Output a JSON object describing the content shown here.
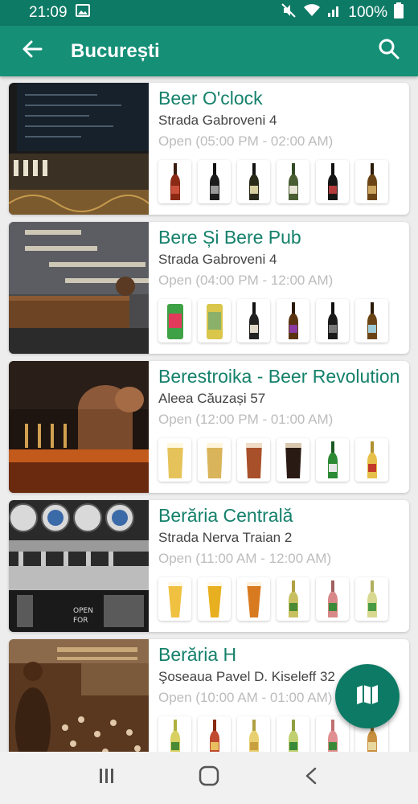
{
  "status": {
    "time": "21:09",
    "battery": "100%"
  },
  "colors": {
    "primary": "#168f77",
    "primary_dark": "#0d7a65",
    "name_text": "#15816b"
  },
  "appbar": {
    "title": "București",
    "back_icon": "arrow-left-icon",
    "search_icon": "search-icon"
  },
  "bars": [
    {
      "name": "Beer O'clock",
      "address": "Strada Gabroveni 4",
      "hours": "Open (05:00 PM - 02:00 AM)",
      "beers": [
        "bottle-red",
        "bottle-dark",
        "bottle-dark",
        "bottle-green",
        "bottle-dark",
        "bottle-amber"
      ]
    },
    {
      "name": "Bere Și Bere Pub",
      "address": "Strada Gabroveni 4",
      "hours": "Open (04:00 PM - 12:00 AM)",
      "beers": [
        "can-green",
        "can-yellow",
        "bottle-dark",
        "bottle-amber",
        "bottle-dark",
        "bottle-amber"
      ]
    },
    {
      "name": "Berestroika - Beer Revolution",
      "address": "Aleea Căuzași 57",
      "hours": "Open (12:00 PM - 01:00 AM)",
      "beers": [
        "glass-yellow",
        "glass-yellow",
        "glass-red",
        "glass-dark",
        "bottle-green",
        "bottle-yellow"
      ]
    },
    {
      "name": "Berăria Centrală",
      "address": "Strada Nerva Traian 2",
      "hours": "Open (11:00 AM - 12:00 AM)",
      "beers": [
        "glass-yellow",
        "glass-yellow",
        "glass-amber",
        "bottle-green",
        "bottle-red",
        "bottle-green"
      ]
    },
    {
      "name": "Berăria H",
      "address": "Şoseaua Pavel D. Kiseleff 32",
      "hours": "Open (10:00 AM - 01:00 AM)",
      "beers": [
        "bottle-green",
        "bottle-red",
        "bottle-yellow",
        "bottle-green",
        "bottle-red",
        "bottle-amber"
      ]
    }
  ],
  "fab": {
    "icon": "map-icon"
  },
  "navbar": {
    "recent_icon": "recent-apps-icon",
    "home_icon": "home-icon",
    "back_icon": "back-nav-icon"
  }
}
